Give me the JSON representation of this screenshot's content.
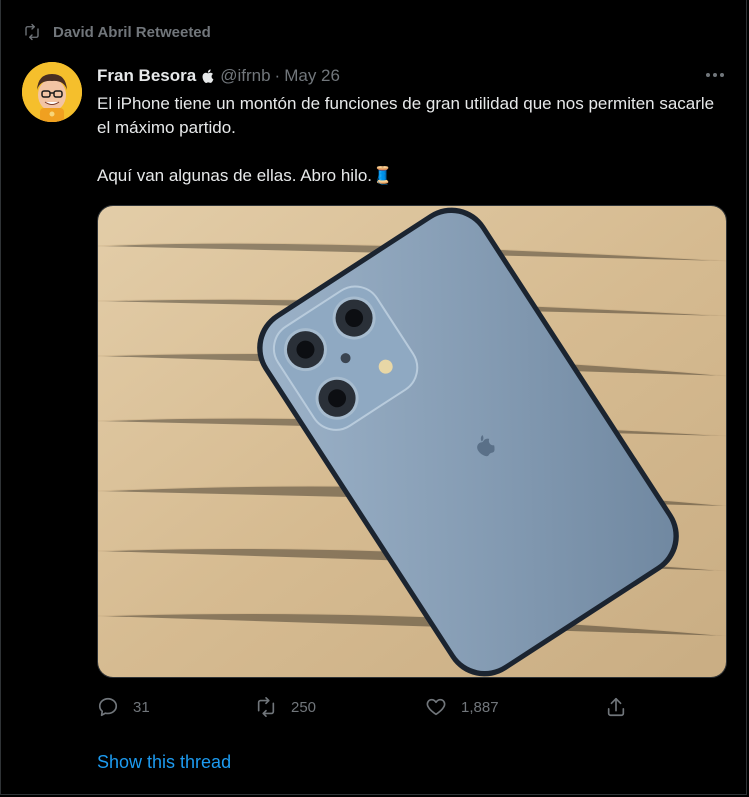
{
  "retweet_banner": {
    "text": "David Abril Retweeted",
    "icon": "retweet-icon"
  },
  "author": {
    "name": "Fran Besora",
    "badge_icon": "apple-logo-icon",
    "handle": "@ifrnb",
    "separator": "·",
    "date": "May 26",
    "avatar_bg": "#f5bf2c"
  },
  "more_icon": "more-options-icon",
  "tweet": {
    "line1": "El iPhone tiene un montón de funciones de gran utilidad que nos permiten sacarle el máximo partido.",
    "line2": "Aquí van algunas de ellas. Abro hilo.🧵"
  },
  "media": {
    "subject": "sierra-blue-iphone-on-wood",
    "bg": "#dcc39c",
    "phone_color": "#8aa3bd"
  },
  "actions": {
    "reply_count": "31",
    "retweet_count": "250",
    "like_count": "1,887"
  },
  "show_thread": "Show this thread",
  "colors": {
    "accent": "#1d9bf0",
    "muted": "#71767b",
    "text": "#e7e9ea",
    "bg": "#000000"
  }
}
